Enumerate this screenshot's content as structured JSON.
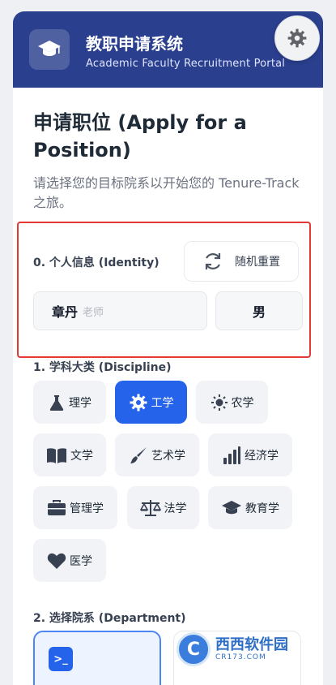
{
  "header": {
    "title": "教职申请系统",
    "subtitle": "Academic Faculty Recruitment Portal",
    "logo_icon": "graduation-cap-icon",
    "settings_icon": "gear-icon"
  },
  "page": {
    "title": "申请职位 (Apply for a Position)",
    "description": "请选择您的目标院系以开始您的 Tenure-Track 之旅。"
  },
  "identity": {
    "label": "0. 个人信息 (Identity)",
    "reset_label": "随机重置",
    "reset_icon": "refresh-icon",
    "name_value": "章丹",
    "name_suffix": "老师",
    "gender_value": "男"
  },
  "discipline": {
    "label": "1. 学科大类 (Discipline)",
    "selected": "工学",
    "items": [
      {
        "label": "理学",
        "icon": "flask-icon"
      },
      {
        "label": "工学",
        "icon": "gear-icon"
      },
      {
        "label": "农学",
        "icon": "sun-icon"
      },
      {
        "label": "文学",
        "icon": "book-icon"
      },
      {
        "label": "艺术学",
        "icon": "brush-icon"
      },
      {
        "label": "经济学",
        "icon": "bar-chart-icon"
      },
      {
        "label": "管理学",
        "icon": "briefcase-icon"
      },
      {
        "label": "法学",
        "icon": "scales-icon"
      },
      {
        "label": "教育学",
        "icon": "graduation-cap-icon"
      },
      {
        "label": "医学",
        "icon": "heart-icon"
      }
    ]
  },
  "department": {
    "label": "2. 选择院系 (Department)",
    "card_icon": "terminal-icon"
  },
  "watermark": {
    "text": "西西软件园",
    "sub": "CR173.COM"
  },
  "colors": {
    "header_bg": "#2a3f8e",
    "accent": "#2563eb",
    "highlight_border": "#e53935"
  }
}
